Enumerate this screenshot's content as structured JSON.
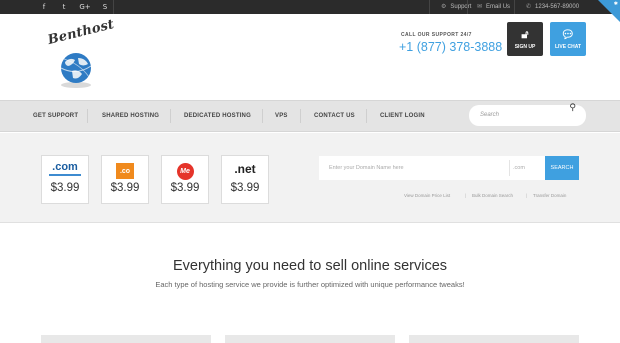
{
  "topbar": {
    "social": [
      {
        "icon": "facebook-icon",
        "glyph": "f"
      },
      {
        "icon": "twitter-icon",
        "glyph": "t"
      },
      {
        "icon": "google-plus-icon",
        "glyph": "G+"
      },
      {
        "icon": "skype-icon",
        "glyph": "S"
      }
    ],
    "support_label": "Support",
    "email_label": "Email Us",
    "phone_label": "1234-567-89000"
  },
  "brand": {
    "logo_text": "Benthost"
  },
  "header": {
    "call_caption": "CALL OUR SUPPORT 24/7",
    "phone": "+1 (877) 378-3888",
    "signup_label": "SIGN UP",
    "livechat_label": "LIVE CHAT"
  },
  "nav": {
    "items": [
      "GET SUPPORT",
      "SHARED HOSTING",
      "DEDICATED HOSTING",
      "VPS",
      "CONTACT US",
      "CLIENT LOGIN"
    ],
    "search_placeholder": "Search"
  },
  "domains": {
    "cards": [
      {
        "tld": ".com",
        "price": "$3.99"
      },
      {
        "tld": ".co",
        "price": "$3.99"
      },
      {
        "tld": "Me",
        "price": "$3.99"
      },
      {
        "tld": ".net",
        "price": "$3.99"
      }
    ],
    "input_placeholder": "Enter your Domain Name here",
    "tld_placeholder": ".com",
    "search_label": "SEARCH",
    "links": [
      "View Domain Price List",
      "Bulk Domain Search",
      "Transfer Domain"
    ],
    "link_separator": "|"
  },
  "intro": {
    "title": "Everything you need to sell online services",
    "subtitle": "Each type of hosting service we provide is further optimized with unique performance tweaks!"
  },
  "colors": {
    "accent": "#3fa0e0",
    "topbar": "#2b2b2b",
    "nav_bg": "#e4e4e4"
  }
}
